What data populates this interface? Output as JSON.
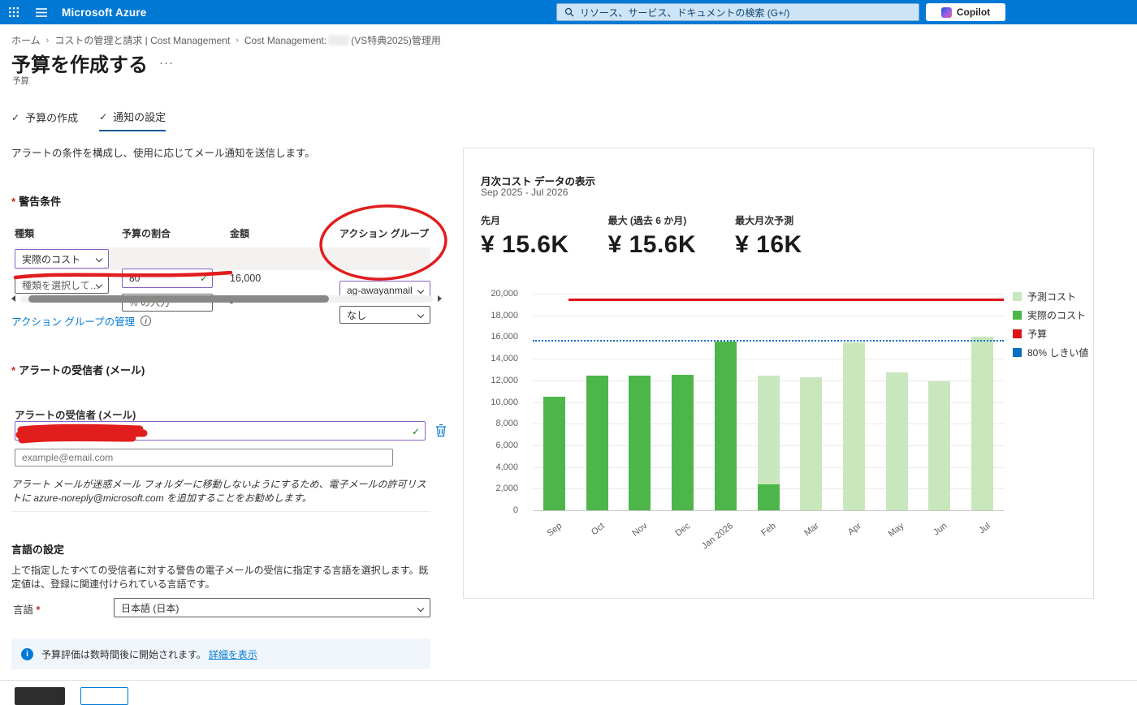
{
  "colors": {
    "accent": "#0078d4",
    "topbar": "#0078d4",
    "annotation_red": "#e11d1d"
  },
  "topbar": {
    "title": "Microsoft Azure",
    "search_placeholder": "リソース、サービス、ドキュメントの検索 (G+/)",
    "copilot_label": "Copilot"
  },
  "breadcrumb": {
    "home": "ホーム",
    "cost_mgmt": "コストの管理と請求 | Cost Management",
    "current_prefix": "Cost Management:",
    "current_suffix": "(VS特典2025)管理用"
  },
  "page": {
    "title": "予算を作成する",
    "subtitle": "予算"
  },
  "steps": {
    "step1": "予算の作成",
    "step2": "通知の設定",
    "check": "✓"
  },
  "intro": "アラートの条件を構成し、使用に応じてメール通知を送信します。",
  "alerts": {
    "section_title": "警告条件",
    "col_type": "種類",
    "col_percent": "予算の割合",
    "col_amount": "金額",
    "col_action_group": "アクション グループ",
    "row1": {
      "type": "実際のコスト",
      "percent": "80",
      "amount": "16,000",
      "action_group": "ag-awayanmail"
    },
    "row2": {
      "type_placeholder": "種類を選択して…",
      "percent_placeholder": "% の入力",
      "amount": "-",
      "action_group": "なし"
    },
    "manage_link": "アクション グループの管理"
  },
  "recipients": {
    "section_title": "アラートの受信者 (メール)",
    "field_label": "アラートの受信者 (メール)",
    "email_placeholder": "example@email.com",
    "note": "アラート メールが迷惑メール フォルダーに移動しないようにするため、電子メールの許可リストに azure-noreply@microsoft.com を追加することをお勧めします。"
  },
  "language": {
    "section_title": "言語の設定",
    "description": "上で指定したすべての受信者に対する警告の電子メールの受信に指定する言語を選択します。既定値は、登録に関連付けられている言語です。",
    "label": "言語",
    "value": "日本語 (日本)"
  },
  "banner": {
    "text": "予算評価は数時間後に開始されます。",
    "link": "詳細を表示"
  },
  "chart_data": {
    "type": "bar",
    "title": "月次コスト データの表示",
    "subtitle": "Sep 2025 - Jul 2026",
    "stats": [
      {
        "label": "先月",
        "value": "¥ 15.6K"
      },
      {
        "label": "最大 (過去 6 か月)",
        "value": "¥ 15.6K"
      },
      {
        "label": "最大月次予測",
        "value": "¥ 16K"
      }
    ],
    "categories": [
      "Sep",
      "Oct",
      "Nov",
      "Dec",
      "Jan 2026",
      "Feb",
      "Mar",
      "Apr",
      "May",
      "Jun",
      "Jul"
    ],
    "series": [
      {
        "name": "実際のコスト",
        "color": "#4db64a",
        "values": [
          10500,
          12400,
          12400,
          12500,
          15600,
          2400,
          0,
          0,
          0,
          0,
          0
        ]
      },
      {
        "name": "予測コスト",
        "color": "#c9e7bd",
        "values": [
          0,
          0,
          0,
          0,
          0,
          10000,
          12300,
          15500,
          12700,
          11900,
          16000
        ]
      }
    ],
    "lines": [
      {
        "name": "予算",
        "value": 20000,
        "color": "#dd1317",
        "style": "solid"
      },
      {
        "name": "80% しきい値",
        "value": 16000,
        "color": "#0b6ec6",
        "style": "dotted"
      }
    ],
    "ylim": [
      0,
      20000
    ],
    "ytick_step": 2000,
    "grid": true,
    "legend_position": "right",
    "legend": [
      {
        "label": "予測コスト",
        "color": "#c9e7bd"
      },
      {
        "label": "実際のコスト",
        "color": "#4db64a"
      },
      {
        "label": "予算",
        "color": "#dd1317"
      },
      {
        "label": "80% しきい値",
        "color": "#0b6ec6"
      }
    ]
  }
}
